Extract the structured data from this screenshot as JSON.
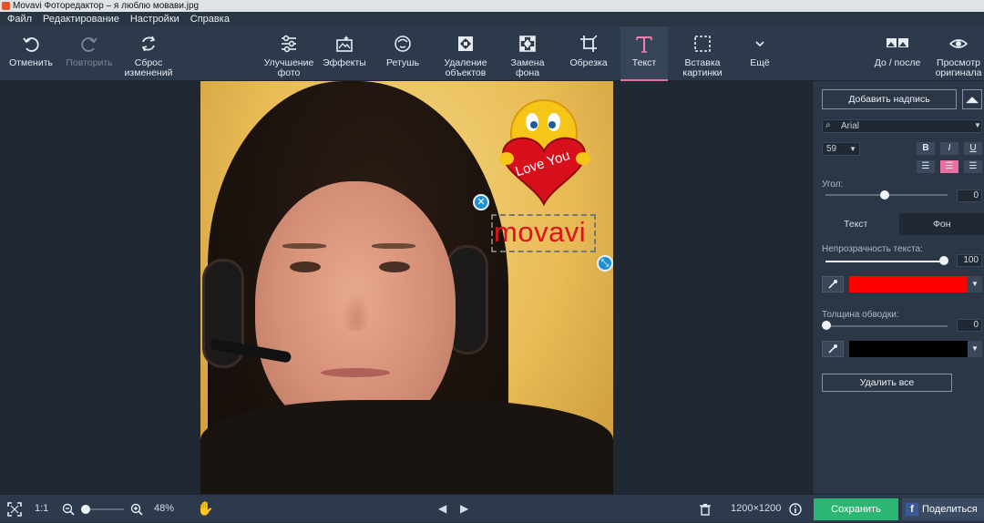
{
  "window": {
    "title": "Movavi Фоторедактор – я люблю мовави.jpg"
  },
  "menu": [
    "Файл",
    "Редактирование",
    "Настройки",
    "Справка"
  ],
  "toolbar": {
    "undo": "Отменить",
    "redo": "Повторить",
    "reset_line1": "Сброс",
    "reset_line2": "изменений",
    "enhance_line1": "Улучшение",
    "enhance_line2": "фото",
    "effects": "Эффекты",
    "retouch": "Ретушь",
    "remove_line1": "Удаление",
    "remove_line2": "объектов",
    "bg_line1": "Замена",
    "bg_line2": "фона",
    "crop": "Обрезка",
    "text": "Текст",
    "insert_line1": "Вставка",
    "insert_line2": "картинки",
    "more": "Ещё",
    "before_after": "До / после",
    "preview_line1": "Просмотр",
    "preview_line2": "оригинала"
  },
  "canvas": {
    "overlay_text": "movavi",
    "sticker_text": "Love You"
  },
  "panel": {
    "add_caption": "Добавить надпись",
    "font": "Arial",
    "size": "59",
    "bold": "B",
    "italic": "I",
    "underline": "U",
    "angle_label": "Угол:",
    "angle_value": "0",
    "tab_text": "Текст",
    "tab_bg": "Фон",
    "opacity_label": "Непрозрачность текста:",
    "opacity_value": "100",
    "text_color": "#ff0000",
    "stroke_label": "Толщина обводки:",
    "stroke_value": "0",
    "stroke_color": "#000000",
    "delete_all": "Удалить все"
  },
  "bottom": {
    "ratio": "1:1",
    "zoom": "48%",
    "dimensions": "1200×1200",
    "save": "Сохранить",
    "share": "Поделиться"
  },
  "colors": {
    "accent": "#e86fa0",
    "save_green": "#2bb673"
  }
}
